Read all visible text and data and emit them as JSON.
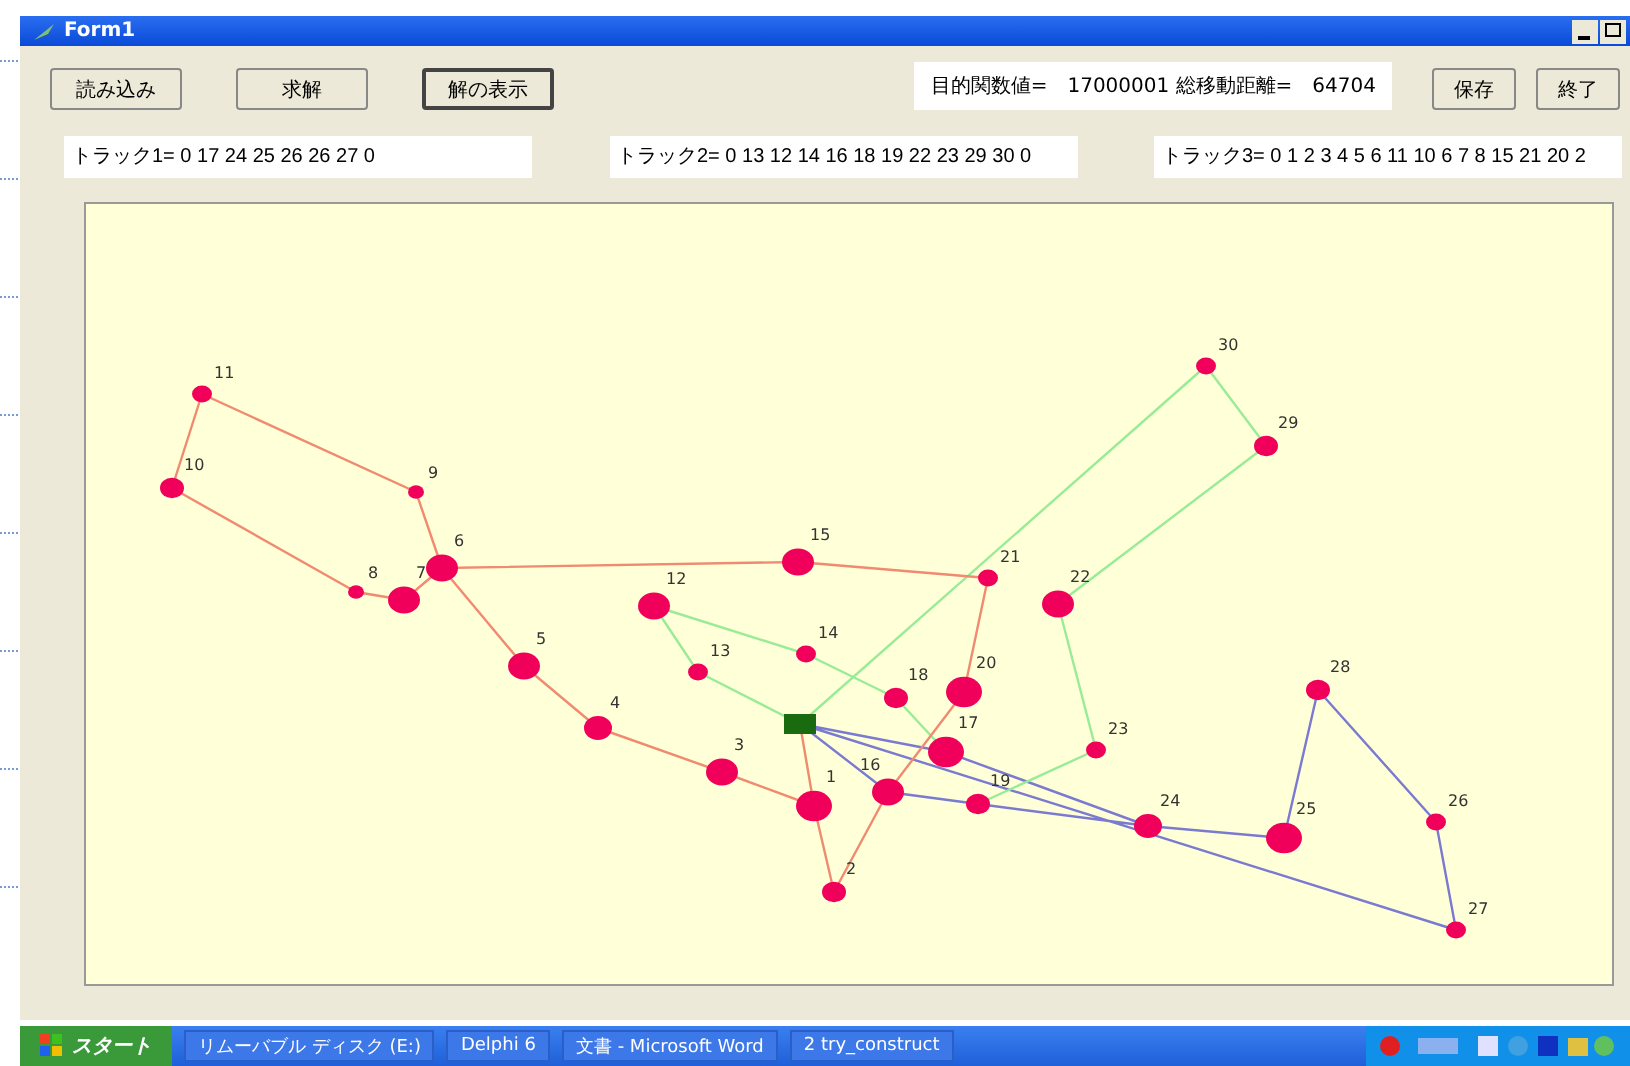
{
  "window": {
    "title": "Form1"
  },
  "buttons": [
    {
      "label": "読み込み",
      "selected": false
    },
    {
      "label": "求解",
      "selected": false
    },
    {
      "label": "解の表示",
      "selected": true
    }
  ],
  "summary": "目的関数値=　17000001 総移動距離=　64704",
  "actions": [
    {
      "label": "保存"
    },
    {
      "label": "終了"
    }
  ],
  "tracks": [
    {
      "text": "トラック1=  0  17 24 25 26 26 27 0"
    },
    {
      "text": "トラック2=  0  13 12 14 16 18 19 22 23 29 30 0"
    },
    {
      "text": "トラック3=  0  1  2  3  4  5  6  11 10 6  7  8  15 21 20 2"
    }
  ],
  "routes": [
    {
      "color": "#7a7ad0"
    },
    {
      "color": "#98ec98"
    },
    {
      "color": "#f08a70"
    }
  ],
  "nodes": [
    {
      "label": "11"
    },
    {
      "label": "10"
    },
    {
      "label": "9"
    },
    {
      "label": "8"
    },
    {
      "label": "7"
    },
    {
      "label": "6"
    },
    {
      "label": "5"
    },
    {
      "label": "4"
    },
    {
      "label": "3"
    },
    {
      "label": "1"
    },
    {
      "label": "2"
    },
    {
      "label": "12"
    },
    {
      "label": "13"
    },
    {
      "label": "14"
    },
    {
      "label": "15"
    },
    {
      "label": "18"
    },
    {
      "label": "17"
    },
    {
      "label": "16"
    },
    {
      "label": "19"
    },
    {
      "label": "20"
    },
    {
      "label": "21"
    },
    {
      "label": "22"
    },
    {
      "label": "23"
    },
    {
      "label": "24"
    },
    {
      "label": "25"
    },
    {
      "label": "26"
    },
    {
      "label": "27"
    },
    {
      "label": "28"
    },
    {
      "label": "29"
    },
    {
      "label": "30"
    }
  ],
  "taskbar": {
    "start": "スタート",
    "items": [
      {
        "label": "リムーバブル ディスク (E:)"
      },
      {
        "label": "Delphi 6"
      },
      {
        "label": "文書 - Microsoft Word"
      },
      {
        "label": "2 try_construct"
      }
    ]
  }
}
